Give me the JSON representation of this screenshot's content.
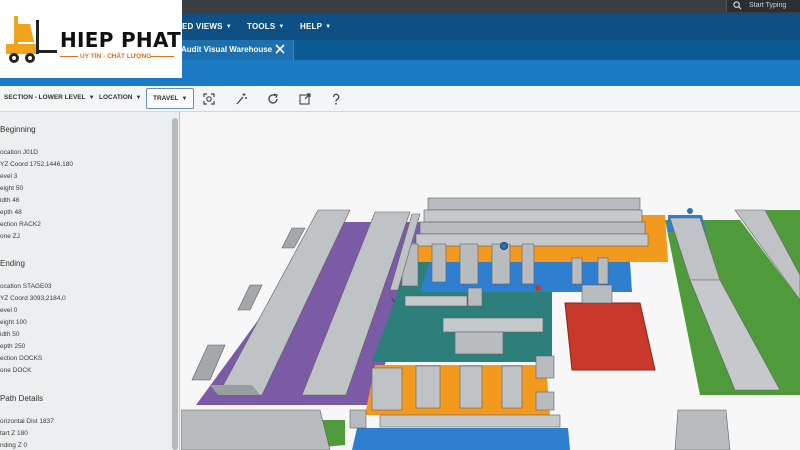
{
  "app": {
    "menu": [
      {
        "label": "ED VIEWS"
      },
      {
        "label": "TOOLS"
      },
      {
        "label": "HELP"
      }
    ],
    "search": {
      "placeholder": "Start Typing"
    }
  },
  "tabs": [
    {
      "label": "Audit Visual Warehouse",
      "active": true
    }
  ],
  "toolbar": {
    "section_label": "SECTION - LOWER LEVEL",
    "location_label": "LOCATION",
    "travel_label": "TRAVEL",
    "icons": [
      "zoom-extent-icon",
      "magic-wand-icon",
      "refresh-icon",
      "external-link-icon",
      "help-icon"
    ]
  },
  "panel": {
    "beginning": {
      "title": "Beginning",
      "fields": [
        "ocation J01D",
        "YZ Coord 1752,1446,180",
        "evel 3",
        "eight 50",
        "idth 46",
        "epth 48",
        "ection RACK2",
        "one ZJ"
      ]
    },
    "ending": {
      "title": "Ending",
      "fields": [
        "ocation STAGE03",
        "YZ Coord 3093,2184,0",
        "evel 0",
        "eight 100",
        "idth 50",
        "epth 250",
        "ection DOCKS",
        "one DOCK"
      ]
    },
    "path": {
      "title": "Path Details",
      "fields": [
        "orizontal Dist 1837",
        "tart Z 180",
        "nding Z 0"
      ]
    }
  },
  "logo": {
    "name": "HIEP PHAT",
    "tagline": "UY TÍN - CHẤT LƯỢNG"
  },
  "colors": {
    "menubar": "#0e4f84",
    "tabbar": "#0b5a93",
    "bluebar": "#1b7ac4",
    "zone_purple": "#7b5aa6",
    "zone_teal": "#2d7f7c",
    "zone_green": "#4f9a3a",
    "zone_orange": "#f39a1e",
    "zone_blue": "#2f7fd0",
    "zone_red": "#c8392b",
    "rack_gray": "#b9bcbf"
  }
}
